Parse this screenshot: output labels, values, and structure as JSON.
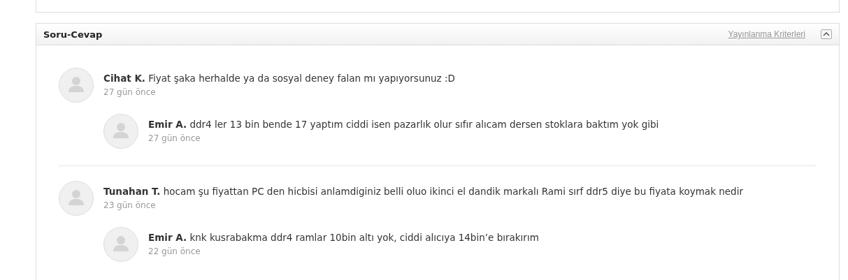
{
  "section": {
    "title": "Soru-Cevap",
    "criteria_link": "Yayınlanma Kriterleri",
    "expanded": true
  },
  "threads": [
    {
      "question": {
        "author": "Cihat K.",
        "text": "Fiyat şaka herhalde ya da sosyal deney falan mı yapıyorsunuz :D",
        "time": "27 gün önce"
      },
      "replies": [
        {
          "author": "Emir A.",
          "text": "ddr4 ler 13 bin bende 17 yaptım ciddi isen pazarlık olur sıfır alıcam dersen stoklara baktım yok gibi",
          "time": "27 gün önce"
        }
      ]
    },
    {
      "question": {
        "author": "Tunahan T.",
        "text": "hocam şu fiyattan PC den hicbisi anlamdiginiz belli oluo ikinci el dandik markalı Rami sırf ddr5 diye bu fiyata koymak nedir",
        "time": "23 gün önce"
      },
      "replies": [
        {
          "author": "Emir A.",
          "text": "knk kusrabakma ddr4 ramlar 10bin altı yok, ciddi alıcıya 14bin’e bırakırım",
          "time": "22 gün önce"
        }
      ]
    }
  ]
}
